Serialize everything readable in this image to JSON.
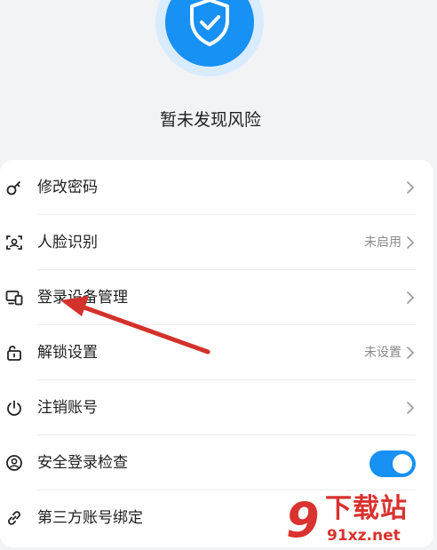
{
  "header": {
    "status_text": "暂未发现风险"
  },
  "settings": {
    "items": [
      {
        "label": "修改密码",
        "value": "",
        "icon": "key-icon",
        "control": "chevron"
      },
      {
        "label": "人脸识别",
        "value": "未启用",
        "icon": "face-scan-icon",
        "control": "chevron"
      },
      {
        "label": "登录设备管理",
        "value": "",
        "icon": "devices-icon",
        "control": "chevron"
      },
      {
        "label": "解锁设置",
        "value": "未设置",
        "icon": "unlock-icon",
        "control": "chevron"
      },
      {
        "label": "注销账号",
        "value": "",
        "icon": "power-icon",
        "control": "chevron"
      },
      {
        "label": "安全登录检查",
        "value": "",
        "icon": "user-circle-icon",
        "control": "toggle",
        "toggle_on": true
      },
      {
        "label": "第三方账号绑定",
        "value": "",
        "icon": "link-icon",
        "control": "none"
      }
    ]
  },
  "watermark": {
    "logo_char": "9",
    "title": "下载站",
    "url": "91xz.net"
  },
  "colors": {
    "accent": "#1791f3",
    "arrow": "#d3312b"
  }
}
